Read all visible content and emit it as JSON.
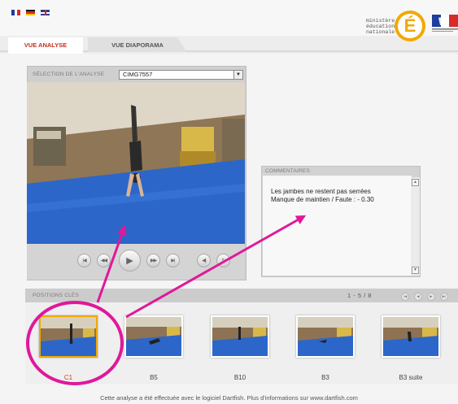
{
  "brand": {
    "ministere_lines": [
      "ministère",
      "éducation",
      "nationale"
    ],
    "e_letter": "É"
  },
  "languages": [
    "fr-flag-icon",
    "de-flag-icon",
    "uk-flag-icon"
  ],
  "tabs": [
    {
      "label": "VUE ANALYSE",
      "active": true
    },
    {
      "label": "VUE DIAPORAMA",
      "active": false
    }
  ],
  "selection": {
    "label": "SÉLECTION DE L'ANALYSE",
    "value": "CIMG7557",
    "arrow": "▼"
  },
  "player": {
    "controls": [
      "first-icon",
      "prev-icon",
      "play-icon",
      "next-icon",
      "last-icon",
      "volume-icon",
      "loop-icon"
    ]
  },
  "comments": {
    "label": "COMMENTAIRES",
    "lines": [
      "Les jambes ne restent pas serrées",
      "Manque de maintien / Faute : - 0.30"
    ]
  },
  "positions": {
    "label": "POSITIONS CLÉS",
    "pager": "1 - 5   / 8",
    "items": [
      {
        "label": "C1",
        "selected": true
      },
      {
        "label": "B5",
        "selected": false
      },
      {
        "label": "B10",
        "selected": false
      },
      {
        "label": "B3",
        "selected": false
      },
      {
        "label": "B3 suite",
        "selected": false
      }
    ]
  },
  "footer": {
    "credit": "Cette analyse a été effectuée avec le logiciel Dartfish. Plus d'informations sur www.dartfish.com"
  },
  "colors": {
    "accent_red": "#c62e1c",
    "annotation_magenta": "#e0189a",
    "mat_blue": "#2c66c9",
    "logo_orange": "#f2a900"
  }
}
